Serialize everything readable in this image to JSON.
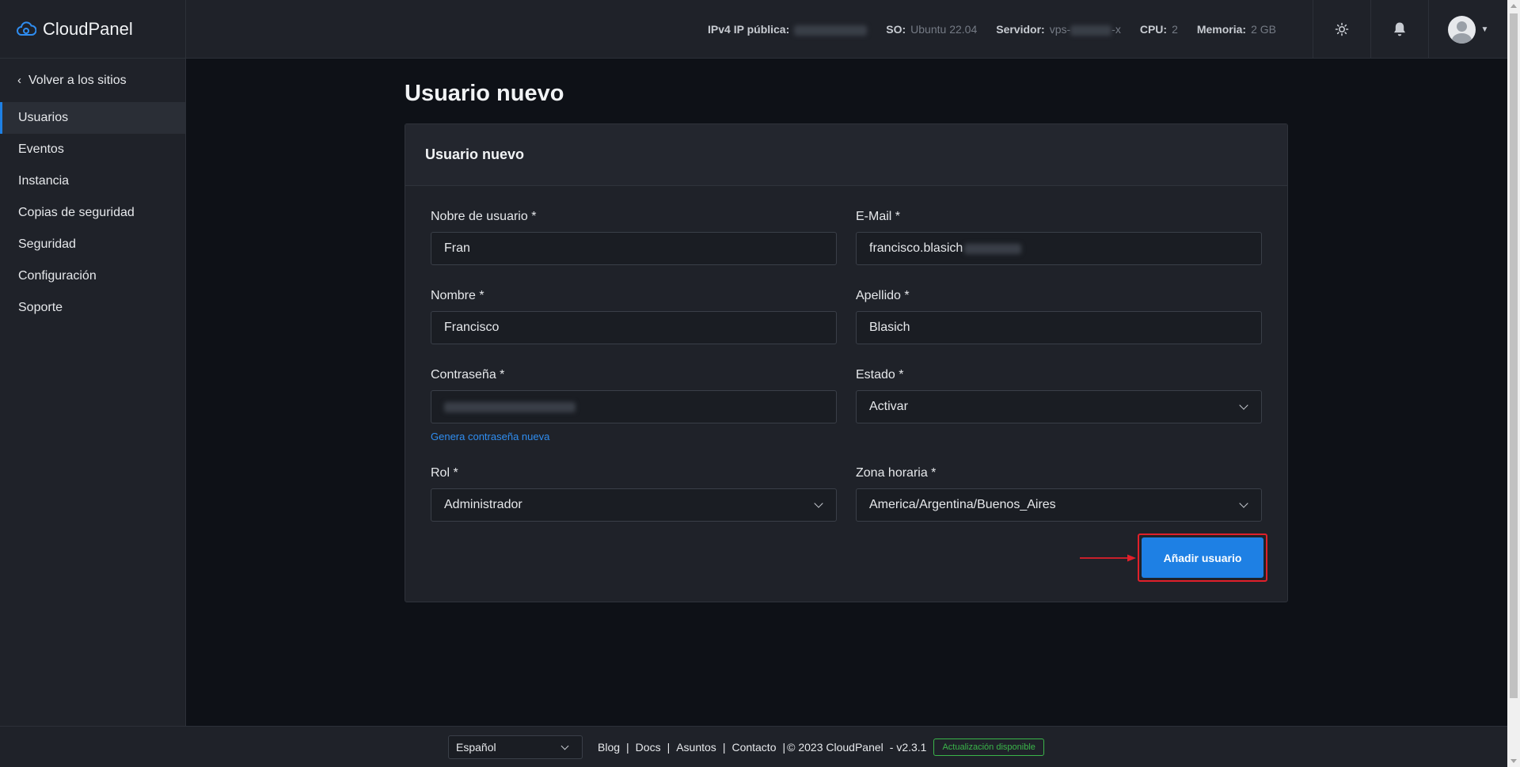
{
  "app": {
    "name": "CloudPanel"
  },
  "sidebar": {
    "back": "Volver a los sitios",
    "items": [
      {
        "label": "Usuarios",
        "active": true
      },
      {
        "label": "Eventos"
      },
      {
        "label": "Instancia"
      },
      {
        "label": "Copias de seguridad"
      },
      {
        "label": "Seguridad"
      },
      {
        "label": "Configuración"
      },
      {
        "label": "Soporte"
      }
    ]
  },
  "topbar": {
    "ip_label": "IPv4 IP pública:",
    "os_label": "SO:",
    "os_value": "Ubuntu 22.04",
    "server_label": "Servidor:",
    "server_prefix": "vps-",
    "server_suffix": "-x",
    "cpu_label": "CPU:",
    "cpu_value": "2",
    "memory_label": "Memoria:",
    "memory_value": "2 GB",
    "icons": [
      "sun-icon",
      "bell-icon",
      "avatar"
    ]
  },
  "page": {
    "title": "Usuario nuevo",
    "card_title": "Usuario nuevo"
  },
  "form": {
    "username": {
      "label": "Nobre de usuario *",
      "value": "Fran"
    },
    "email": {
      "label": "E-Mail *",
      "value": "francisco.blasich"
    },
    "first_name": {
      "label": "Nombre *",
      "value": "Francisco"
    },
    "last_name": {
      "label": "Apellido *",
      "value": "Blasich"
    },
    "password": {
      "label": "Contraseña *",
      "generate_link": "Genera contraseña nueva"
    },
    "status": {
      "label": "Estado *",
      "value": "Activar"
    },
    "role": {
      "label": "Rol *",
      "value": "Administrador"
    },
    "timezone": {
      "label": "Zona horaria *",
      "value": "America/Argentina/Buenos_Aires"
    },
    "submit": "Añadir usuario"
  },
  "footer": {
    "language": "Español",
    "links": [
      "Blog",
      "Docs",
      "Asuntos",
      "Contacto"
    ],
    "copyright": "© 2023  CloudPanel",
    "version": "- v2.3.1",
    "update_badge": "Actualización disponible"
  },
  "colors": {
    "accent": "#1e80e4",
    "highlight": "#e0202a",
    "update": "#3bb54a"
  }
}
